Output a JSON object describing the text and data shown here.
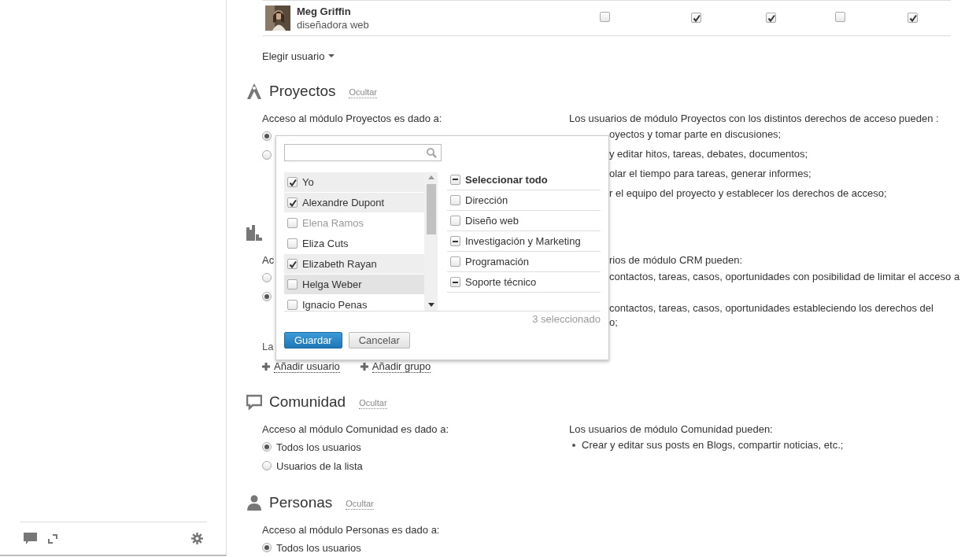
{
  "user_row": {
    "name": "Meg Griffin",
    "role": "diseñadora web",
    "permissions": [
      false,
      true,
      true,
      false,
      true
    ]
  },
  "choose_user": "Elegir usuario",
  "sections": [
    {
      "title": "Proyectos",
      "hide_link": "Ocultar",
      "access_label": "Acceso al módulo Proyectos es dado a:",
      "options": [
        {
          "selected": true
        },
        {
          "selected": false
        }
      ],
      "rights_title": "Los usuarios de módulo Proyectos con los distintos derechos de acceso pueden :",
      "rights": [
        {
          "lines": [
            "oyectos y tomar parte en discusiones;"
          ],
          "cut": true
        },
        {
          "lines": [
            "y editar hitos, tareas, debates, documentos;"
          ],
          "cut": true
        },
        {
          "lines": [
            "olar el tiempo para tareas, generar informes;"
          ],
          "cut": true
        },
        {
          "lines": [
            "r el equipo del proyecto y establecer los derechos de acceso;"
          ],
          "cut": true
        }
      ]
    },
    {
      "access_label": "Ac",
      "options": [
        {
          "selected": false
        },
        {
          "selected": true
        }
      ],
      "list_note": "La",
      "add_links": [
        "Añadir usuario",
        "Añadir grupo"
      ],
      "rights_title": "rios de módulo CRM pueden:",
      "rights_title_cut": true,
      "rights": [
        {
          "lines": [
            "contactos, tareas, casos, oportunidades con posibilidad de limitar el acceso a"
          ],
          "cut": true
        },
        {
          "lines": [
            "contactos, tareas, casos, oportunidades estableciendo los derechos del",
            "o;"
          ],
          "cut": true
        }
      ]
    },
    {
      "title": "Comunidad",
      "hide_link": "Ocultar",
      "access_label": "Acceso al módulo Comunidad es dado a:",
      "options": [
        {
          "label": "Todos los usuarios",
          "selected": true
        },
        {
          "label": "Usuarios de la lista",
          "selected": false
        }
      ],
      "rights_title": "Los usuarios de módulo Comunidad pueden:",
      "rights": [
        {
          "lines": [
            "Crear y editar sus posts en Blogs, compartir noticias, etc.;"
          ],
          "cut": false
        }
      ]
    },
    {
      "title": "Personas",
      "hide_link": "Ocultar",
      "access_label": "Acceso al módulo Personas es dado a:",
      "options": [
        {
          "label": "Todos los usuarios",
          "selected": true
        }
      ]
    }
  ],
  "selector": {
    "users": [
      {
        "name": "Yo",
        "checked": true,
        "disabled": false,
        "hovered": false
      },
      {
        "name": "Alexandre Dupont",
        "checked": true,
        "disabled": false,
        "hovered": false
      },
      {
        "name": "Elena Ramos",
        "checked": false,
        "disabled": true,
        "hovered": false
      },
      {
        "name": "Eliza Cuts",
        "checked": false,
        "disabled": false,
        "hovered": false
      },
      {
        "name": "Elizabeth Rayan",
        "checked": true,
        "disabled": false,
        "hovered": false
      },
      {
        "name": "Helga Weber",
        "checked": false,
        "disabled": false,
        "hovered": true
      },
      {
        "name": "Ignacio Penas",
        "checked": false,
        "disabled": false,
        "hovered": false
      }
    ],
    "select_all": {
      "label": "Seleccionar todo",
      "checked": false,
      "partial": true
    },
    "groups": [
      {
        "name": "Dirección",
        "checked": false,
        "partial": false
      },
      {
        "name": "Diseño web",
        "checked": false,
        "partial": false
      },
      {
        "name": "Investigación y Marketing",
        "checked": false,
        "partial": true
      },
      {
        "name": "Programación",
        "checked": false,
        "partial": false
      },
      {
        "name": "Soporte técnico",
        "checked": false,
        "partial": true
      }
    ],
    "count": "3 seleccionado",
    "buttons": [
      {
        "label": "Guardar",
        "kind": "primary"
      },
      {
        "label": "Cancelar",
        "kind": "secondary"
      }
    ]
  }
}
